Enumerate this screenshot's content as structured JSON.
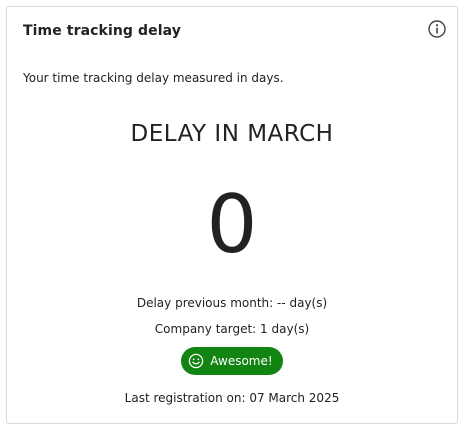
{
  "widget": {
    "title": "Time tracking delay",
    "info_icon": "info-circle-icon",
    "subtitle": "Your time tracking delay measured in days.",
    "period_heading": "DELAY IN MARCH",
    "delay_value": "0",
    "previous_month": "Delay previous month: -- day(s)",
    "company_target": "Company target: 1 day(s)",
    "badge": {
      "label": "Awesome!",
      "icon": "smiley-face-icon",
      "color": "#128412"
    },
    "last_registration": "Last registration on: 07 March 2025"
  }
}
